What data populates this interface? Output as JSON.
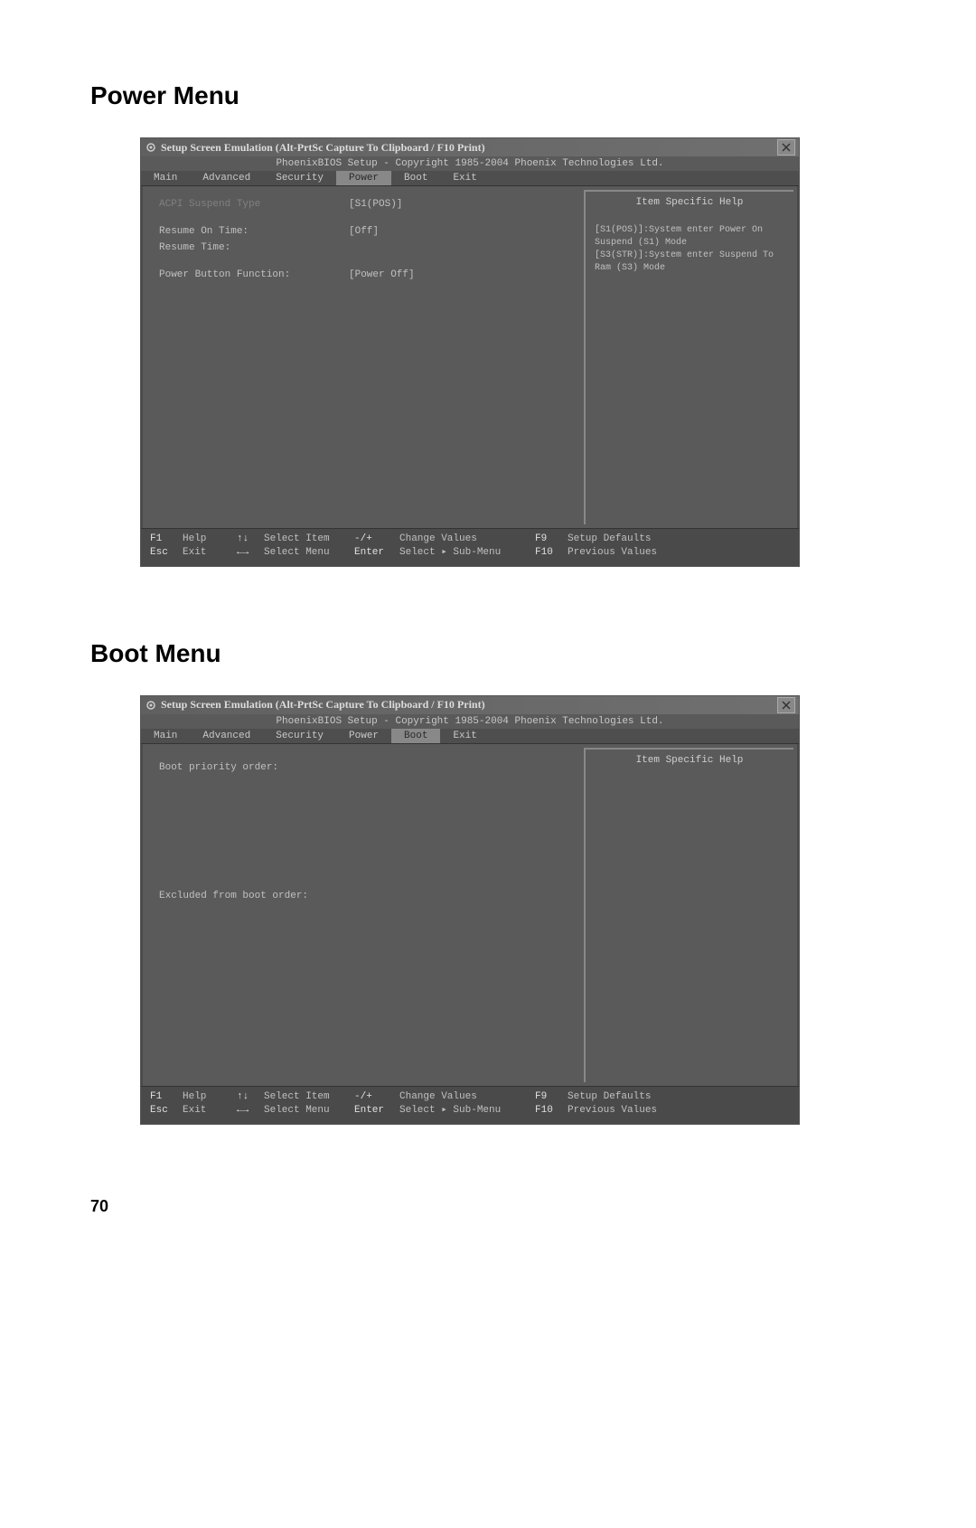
{
  "page_number": "70",
  "sections": {
    "power": {
      "heading": "Power Menu",
      "window_title": "Setup Screen Emulation (Alt-PrtSc Capture To Clipboard / F10 Print)",
      "copyright": "PhoenixBIOS Setup - Copyright 1985-2004 Phoenix Technologies Ltd.",
      "tabs": [
        "Main",
        "Advanced",
        "Security",
        "Power",
        "Boot",
        "Exit"
      ],
      "active_tab": "Power",
      "settings": [
        {
          "label": "ACPI Suspend Type",
          "value": "[S1(POS)]",
          "highlight": true
        },
        {
          "label": "Resume On Time:",
          "value": "[Off]"
        },
        {
          "label": "Resume Time:",
          "value": ""
        },
        {
          "label": "Power Button Function:",
          "value": "[Power Off]"
        }
      ],
      "help_title": "Item Specific Help",
      "help_text": "[S1(POS)]:System enter Power On Suspend (S1) Mode\n[S3(STR)]:System enter Suspend To Ram (S3) Mode"
    },
    "boot": {
      "heading": "Boot Menu",
      "window_title": "Setup Screen Emulation (Alt-PrtSc Capture To Clipboard / F10 Print)",
      "copyright": "PhoenixBIOS Setup - Copyright 1985-2004 Phoenix Technologies Ltd.",
      "tabs": [
        "Main",
        "Advanced",
        "Security",
        "Power",
        "Boot",
        "Exit"
      ],
      "active_tab": "Boot",
      "labels": {
        "priority": "Boot priority order:",
        "excluded": "Excluded from boot order:"
      },
      "help_title": "Item Specific Help"
    }
  },
  "footer": {
    "row1": {
      "k1": "F1",
      "l1": "Help",
      "k2": "↑↓",
      "l2": "Select Item",
      "k3": "-/+",
      "l3": "Change Values",
      "k4": "F9",
      "l4": "Setup Defaults"
    },
    "row2": {
      "k1": "Esc",
      "l1": "Exit",
      "k2": "←→",
      "l2": "Select Menu",
      "k3": "Enter",
      "l3": "Select ▸ Sub-Menu",
      "k4": "F10",
      "l4": "Previous Values"
    }
  }
}
